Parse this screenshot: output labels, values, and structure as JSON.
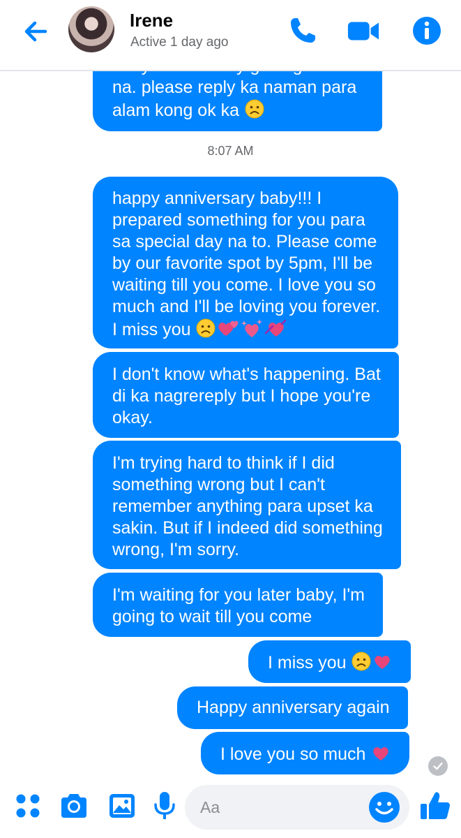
{
  "header": {
    "contact_name": "Irene",
    "status": "Active 1 day ago"
  },
  "messages": [
    {
      "text": "baby. I'm actually getting worried\nna. please reply ka naman para\nalam kong ok ka ",
      "emoji": [
        "sad-face"
      ]
    },
    {
      "text": "happy anniversary baby!!! I\nprepared something for you para\nsa special day na to. Please come\nby our favorite spot by 5pm, I'll be\nwaiting till you come. I love you so\nmuch and I'll be loving you forever.\nI miss you ",
      "emoji": [
        "sad-face",
        "two-hearts",
        "sparkling-hearts",
        "heart-with-ribbon"
      ]
    },
    {
      "text": "I don't know what's happening. Bat\ndi ka nagrereply but I hope you're\nokay."
    },
    {
      "text": "I'm trying hard to think if I did\nsomething wrong but I can't\nremember anything para upset ka\nsakin. But if I indeed did something\nwrong, I'm sorry."
    },
    {
      "text": "I'm waiting for you later baby, I'm\ngoing to wait till you come"
    },
    {
      "text": "I miss you ",
      "emoji": [
        "sad-face",
        "heart"
      ]
    },
    {
      "text": "Happy anniversary again"
    },
    {
      "text": "I love you so much ",
      "emoji": [
        "heart"
      ]
    }
  ],
  "timestamp": "8:07 AM",
  "composer": {
    "placeholder": "Aa"
  },
  "colors": {
    "accent": "#0084ff",
    "bubble_text": "#ffffff",
    "heart": "#e8457a",
    "emoji_yellow": "#ffcc33"
  },
  "icons": [
    "back-arrow-icon",
    "phone-icon",
    "video-camera-icon",
    "info-icon",
    "apps-grid-icon",
    "camera-icon",
    "gallery-icon",
    "microphone-icon",
    "smiley-icon",
    "thumbs-up-icon",
    "seen-check-icon"
  ]
}
